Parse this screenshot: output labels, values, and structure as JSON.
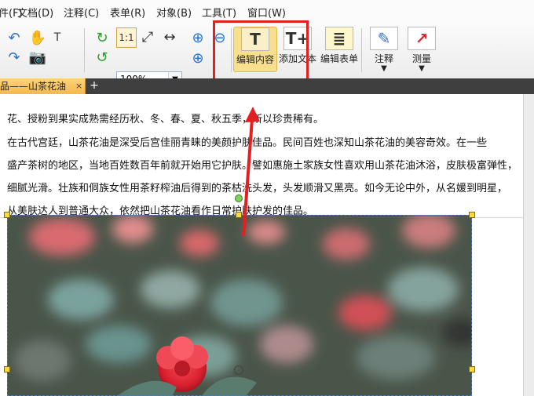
{
  "menu": [
    {
      "label": "件(F)"
    },
    {
      "label": "文档(D)"
    },
    {
      "label": "注释(C)"
    },
    {
      "label": "表单(R)"
    },
    {
      "label": "对象(B)"
    },
    {
      "label": "工具(T)"
    },
    {
      "label": "窗口(W)"
    }
  ],
  "toolbar": {
    "zoom_value": "100%",
    "buttons": {
      "edit_content": "编辑内容",
      "add_text": "添加文本",
      "edit_form": "编辑表单",
      "annotate": "注释",
      "measure": "测量"
    }
  },
  "tabs": {
    "active_title": "品——山茶花油",
    "close_glyph": "×",
    "add_glyph": "+"
  },
  "document": {
    "lines": [
      "花、授粉到果实成熟需经历秋、冬、春、夏、秋五季，所以珍贵稀有。",
      "    在古代宫廷，山茶花油是深受后宫佳丽青睐的美颜护肤佳品。民间百姓也深知山茶花油的美容奇效。在一些",
      "盛产茶树的地区，当地百姓数百年前就开始用它护肤。譬如惠施土家族女性喜欢用山茶花油沐浴，皮肤极富弹性，",
      "细腻光滑。壮族和侗族女性用茶籽榨油后得到的茶枯洗头发，头发顺滑又黑亮。如今无论中外，从名媛到明星，",
      "从美肤达人到普通大众，依然把山茶花油看作日常护肤护发的佳品。"
    ]
  },
  "colors": {
    "accent": "#e41f1f",
    "active_tab": "#f4b94c",
    "toolbar_bg": "#ececec",
    "selection_handle": "#ffd83b"
  }
}
